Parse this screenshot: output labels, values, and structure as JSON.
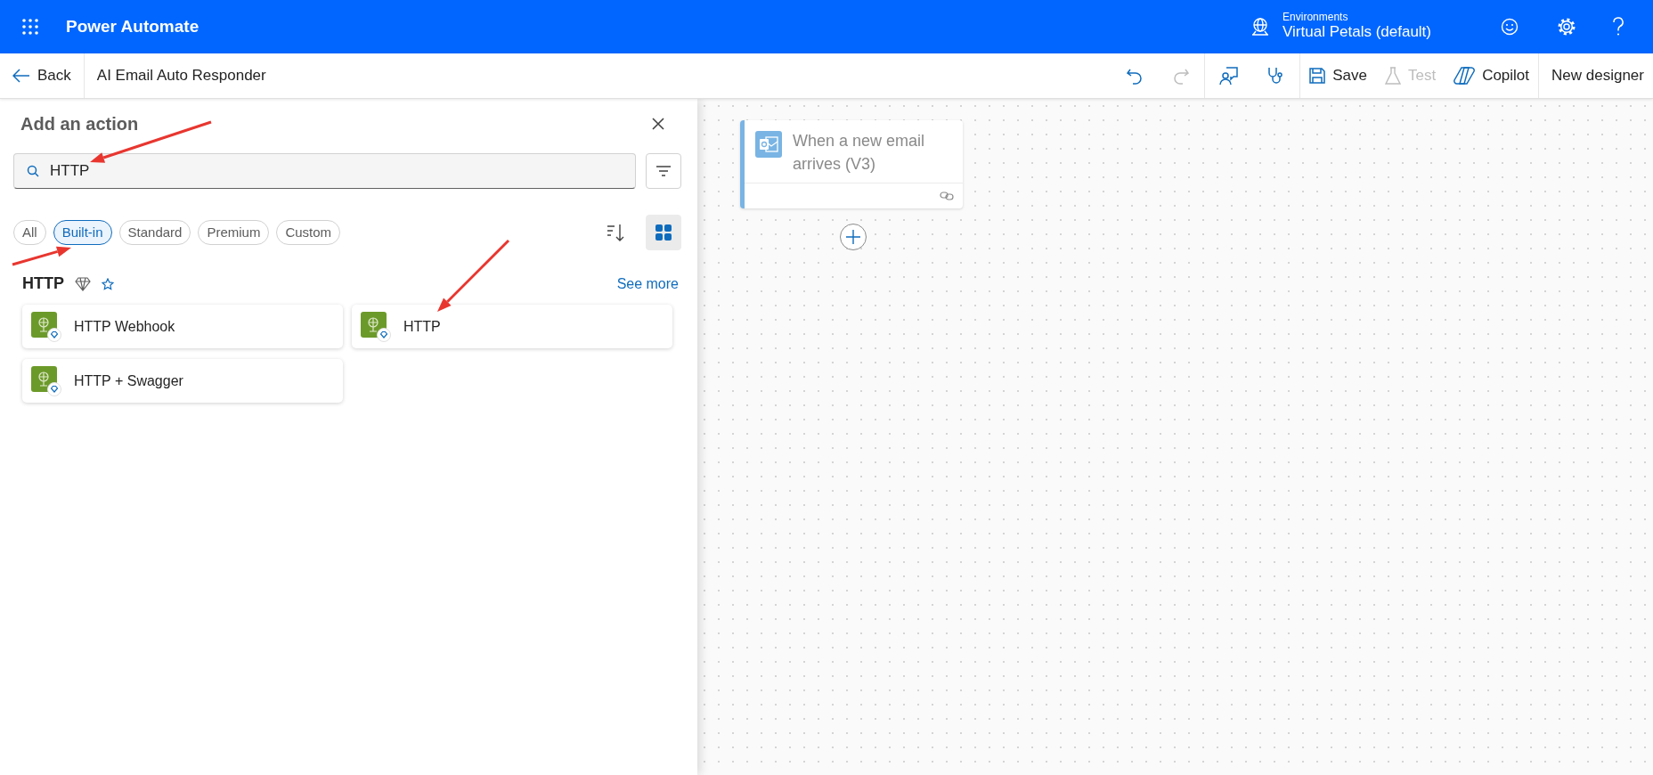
{
  "app_bar": {
    "title": "Power Automate",
    "environment": {
      "label": "Environments",
      "name": "Virtual Petals (default)"
    }
  },
  "toolbar": {
    "back": "Back",
    "flow_name": "AI Email Auto Responder",
    "icon_buttons": [
      {
        "kind": "undo",
        "disabled": false
      },
      {
        "kind": "redo",
        "disabled": true
      },
      {
        "kind": "chat",
        "disabled": false
      },
      {
        "kind": "checker",
        "disabled": false
      }
    ],
    "buttons": [
      {
        "kind": "save",
        "label": "Save",
        "disabled": false
      },
      {
        "kind": "test",
        "label": "Test",
        "disabled": true
      },
      {
        "kind": "copilot",
        "label": "Copilot",
        "disabled": false
      }
    ],
    "designer_label": "New designer"
  },
  "panel": {
    "title": "Add an action",
    "search": {
      "value": "HTTP"
    },
    "filters": [
      {
        "label": "All",
        "selected": false
      },
      {
        "label": "Built-in",
        "selected": true
      },
      {
        "label": "Standard",
        "selected": false
      },
      {
        "label": "Premium",
        "selected": false
      },
      {
        "label": "Custom",
        "selected": false
      }
    ],
    "view_buttons": [
      {
        "kind": "sort",
        "selected": false
      },
      {
        "kind": "grid",
        "selected": true
      }
    ],
    "groups": [
      {
        "title": "HTTP",
        "see_more": "See more",
        "actions": [
          {
            "label": "HTTP Webhook"
          },
          {
            "label": "HTTP"
          },
          {
            "label": "HTTP + Swagger"
          }
        ]
      }
    ]
  },
  "canvas": {
    "nodes": [
      {
        "title": "When a new email arrives (V3)"
      }
    ]
  }
}
